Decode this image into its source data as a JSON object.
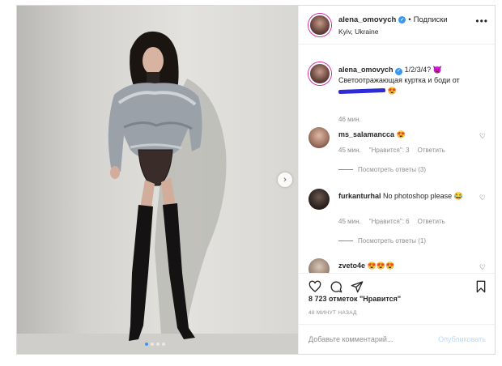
{
  "post": {
    "author": "alena_omovych",
    "separator": "•",
    "follow_label": "Подписки",
    "location": "Kyiv, Ukraine",
    "more_label": "•••"
  },
  "caption": {
    "author": "alena_omovych",
    "line1": "1/2/3/4?",
    "line1_emoji": "😈",
    "line2": "Светоотражающая куртка и боди от",
    "emoji_end": "😍",
    "time": "46 мин."
  },
  "comments": [
    {
      "user": "ms_salamancca",
      "text": "😍",
      "time": "45 мин.",
      "likes": "\"Нравится\": 3",
      "reply": "Ответить",
      "replies": "Посмотреть ответы (3)"
    },
    {
      "user": "furkanturhal",
      "text": "No photoshop please 😂",
      "time": "45 мин.",
      "likes": "\"Нравится\": 6",
      "reply": "Ответить",
      "replies": "Посмотреть ответы (1)"
    },
    {
      "user": "zveto4e",
      "text": "😍😍😍"
    }
  ],
  "stats": {
    "likes": "8 723 отметок \"Нравится\"",
    "ago": "48 МИНУТ НАЗАД"
  },
  "composer": {
    "placeholder": "Добавьте комментарий...",
    "post_label": "Опубликовать"
  },
  "icons": {
    "next": "chevron-right-icon",
    "like": "heart-icon",
    "comment": "comment-icon",
    "share": "share-icon",
    "save": "bookmark-icon"
  },
  "colors": {
    "verified": "#3897f0",
    "publish_disabled": "#b3dbff",
    "muted": "#8e8e8e"
  }
}
